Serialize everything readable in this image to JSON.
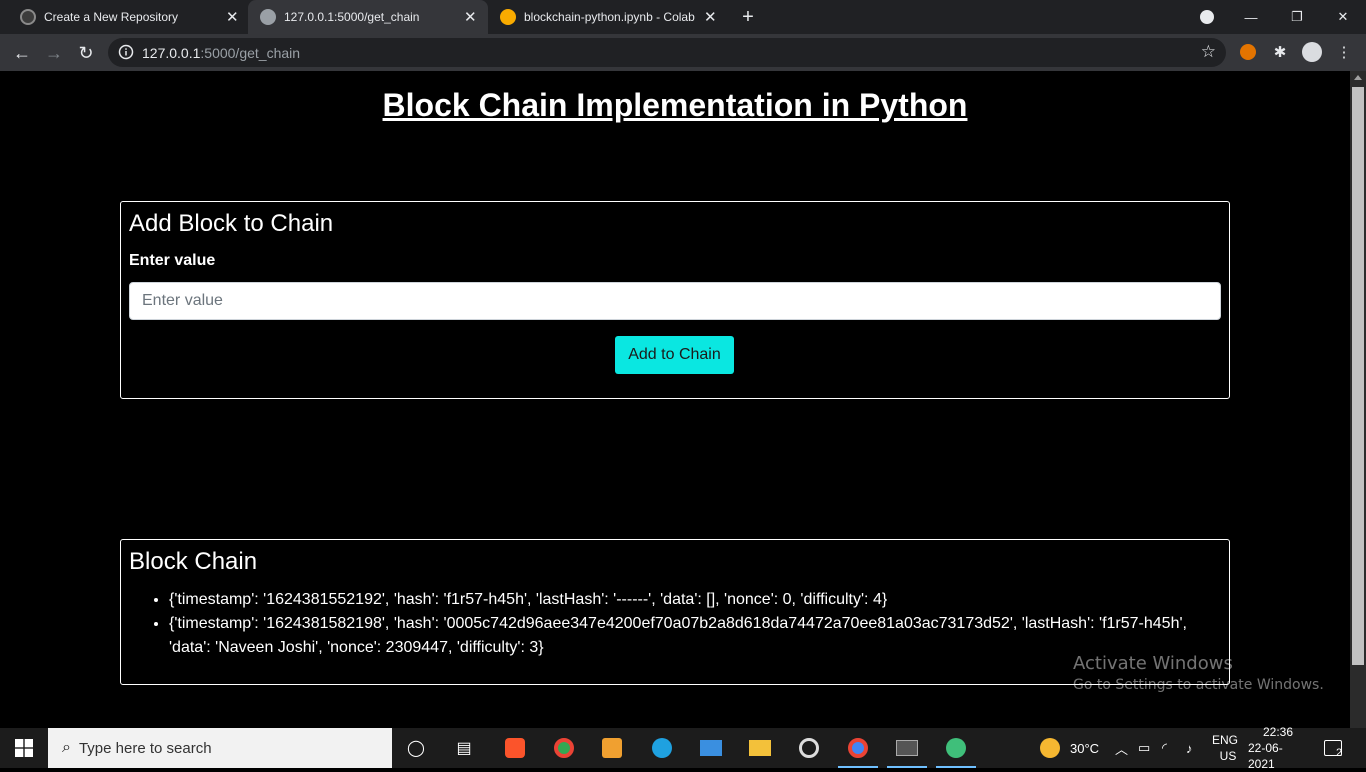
{
  "browser": {
    "tabs": [
      {
        "title": "Create a New Repository",
        "favicon": "github-icon"
      },
      {
        "title": "127.0.0.1:5000/get_chain",
        "favicon": "globe-icon"
      },
      {
        "title": "blockchain-python.ipynb - Colab",
        "favicon": "colab-icon"
      }
    ],
    "new_tab": "+",
    "url_host": "127.0.0.1",
    "url_path": ":5000/get_chain",
    "colors": {
      "tabbar": "#202124",
      "toolbar": "#35363a"
    }
  },
  "page": {
    "title": "Block Chain Implementation in Python",
    "add_card": {
      "heading": "Add Block to Chain",
      "field_label": "Enter value",
      "input_placeholder": "Enter value",
      "input_value": "",
      "button_label": "Add to Chain",
      "button_color": "#0ae7e1"
    },
    "chain_card": {
      "heading": "Block Chain",
      "blocks": [
        "{'timestamp': '1624381552192', 'hash': 'f1r57-h45h', 'lastHash': '------', 'data': [], 'nonce': 0, 'difficulty': 4}",
        "{'timestamp': '1624381582198', 'hash': '0005c742d96aee347e4200ef70a07b2a8d618da74472a70ee81a03ac73173d52', 'lastHash': 'f1r57-h45h', 'data': 'Naveen Joshi', 'nonce': 2309447, 'difficulty': 3}"
      ]
    },
    "watermark": {
      "line1": "Activate Windows",
      "line2": "Go to Settings to activate Windows."
    }
  },
  "taskbar": {
    "search_placeholder": "Type here to search",
    "weather": "30°C",
    "language": "ENG",
    "region": "US",
    "time": "22:36",
    "date": "22-06-2021",
    "notifications": "2"
  }
}
